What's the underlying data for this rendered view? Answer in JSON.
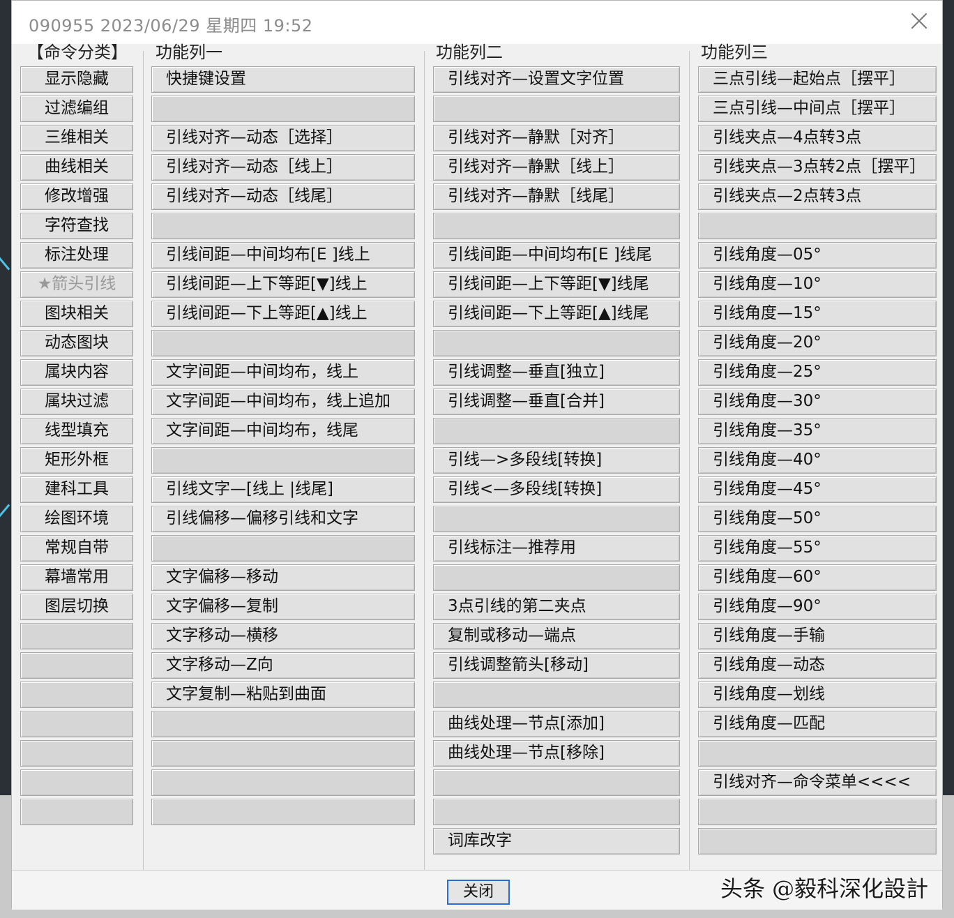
{
  "window": {
    "title": "090955 2023/06/29 星期四 19:52"
  },
  "headers": {
    "category": "【命令分类】",
    "col1": "功能列一",
    "col2": "功能列二",
    "col3": "功能列三"
  },
  "categories": [
    "显示隐藏",
    "过滤编组",
    "三维相关",
    "曲线相关",
    "修改增强",
    "字符查找",
    "标注处理",
    "★箭头引线",
    "图块相关",
    "动态图块",
    "属块内容",
    "属块过滤",
    "线型填充",
    "矩形外框",
    "建科工具",
    "绘图环境",
    "常规自带",
    "幕墙常用",
    "图层切换",
    "",
    "",
    "",
    "",
    "",
    "",
    ""
  ],
  "col1": [
    "快捷键设置",
    "",
    "引线对齐—动态［选择］",
    "引线对齐—动态［线上］",
    "引线对齐—动态［线尾］",
    "",
    "引线间距—中间均布[Ε ]线上",
    "引线间距—上下等距[▼]线上",
    "引线间距—下上等距[▲]线上",
    "",
    "文字间距—中间均布，线上",
    "文字间距—中间均布，线上追加",
    "文字间距—中间均布，线尾",
    "",
    "引线文字—[线上 |线尾]",
    "引线偏移—偏移引线和文字",
    "",
    "文字偏移—移动",
    "文字偏移—复制",
    "文字移动—横移",
    "文字移动—Z向",
    "文字复制—粘贴到曲面",
    "",
    "",
    "",
    ""
  ],
  "col2": [
    "引线对齐—设置文字位置",
    "",
    "引线对齐—静默［对齐］",
    "引线对齐—静默［线上］",
    "引线对齐—静默［线尾］",
    "",
    "引线间距—中间均布[Ε ]线尾",
    "引线间距—上下等距[▼]线尾",
    "引线间距—下上等距[▲]线尾",
    "",
    "引线调整—垂直[独立]",
    "引线调整—垂直[合并]",
    "",
    "引线—>多段线[转换]",
    "引线<—多段线[转换]",
    "",
    "引线标注—推荐用",
    "",
    "3点引线的第二夹点",
    "复制或移动—端点",
    "引线调整箭头[移动]",
    "",
    "曲线处理—节点[添加]",
    "曲线处理—节点[移除]",
    "",
    "",
    "词库改字"
  ],
  "col3": [
    "三点引线—起始点［摆平］",
    "三点引线—中间点［摆平］",
    "引线夹点—4点转3点",
    "引线夹点—3点转2点［摆平］",
    "引线夹点—2点转3点",
    "",
    "引线角度—05°",
    "引线角度—10°",
    "引线角度—15°",
    "引线角度—20°",
    "引线角度—25°",
    "引线角度—30°",
    "引线角度—35°",
    "引线角度—40°",
    "引线角度—45°",
    "引线角度—50°",
    "引线角度—55°",
    "引线角度—60°",
    "引线角度—90°",
    "引线角度—手输",
    "引线角度—动态",
    "引线角度—划线",
    "引线角度—匹配",
    "",
    "引线对齐—命令菜单<<<<",
    "",
    ""
  ],
  "footer": {
    "close_label": "关闭",
    "watermark": "头条 @毅科深化設計"
  }
}
